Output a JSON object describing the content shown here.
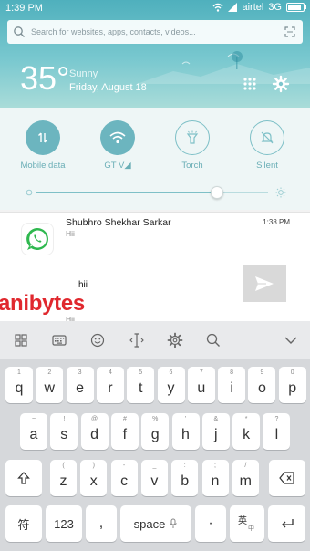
{
  "status_bar": {
    "time": "1:39 PM",
    "carrier": "airtel",
    "network": "3G",
    "battery_level": 0.8
  },
  "search": {
    "placeholder": "Search for websites, apps, contacts, videos..."
  },
  "weather": {
    "temperature": "35°",
    "condition": "Sunny",
    "date": "Friday, August 18"
  },
  "toggles": [
    {
      "label": "Mobile data",
      "icon": "data-arrows-icon",
      "state": "on"
    },
    {
      "label": "GT V◢",
      "icon": "wifi-icon",
      "state": "on"
    },
    {
      "label": "Torch",
      "icon": "torch-icon",
      "state": "off"
    },
    {
      "label": "Silent",
      "icon": "bell-off-icon",
      "state": "off"
    }
  ],
  "brightness": {
    "level": 0.78
  },
  "notification": {
    "app_icon": "whatsapp-icon",
    "sender": "Shubhro Shekhar Sarkar",
    "time": "1:38 PM",
    "message": "Hii",
    "reply_text": "hii",
    "message_repeat": "Hii",
    "watermark": "anibytes"
  },
  "keyboard": {
    "toolbar_icons": [
      "grid-icon",
      "keyboard-icon",
      "emoji-icon",
      "cursor-icon",
      "settings-icon",
      "search-icon",
      "collapse-icon"
    ],
    "row1": [
      {
        "hint": "1",
        "key": "q"
      },
      {
        "hint": "2",
        "key": "w"
      },
      {
        "hint": "3",
        "key": "e"
      },
      {
        "hint": "4",
        "key": "r"
      },
      {
        "hint": "5",
        "key": "t"
      },
      {
        "hint": "6",
        "key": "y"
      },
      {
        "hint": "7",
        "key": "u"
      },
      {
        "hint": "8",
        "key": "i"
      },
      {
        "hint": "9",
        "key": "o"
      },
      {
        "hint": "0",
        "key": "p"
      }
    ],
    "row2": [
      {
        "hint": "~",
        "key": "a"
      },
      {
        "hint": "!",
        "key": "s"
      },
      {
        "hint": "@",
        "key": "d"
      },
      {
        "hint": "#",
        "key": "f"
      },
      {
        "hint": "%",
        "key": "g"
      },
      {
        "hint": "'",
        "key": "h"
      },
      {
        "hint": "&",
        "key": "j"
      },
      {
        "hint": "*",
        "key": "k"
      },
      {
        "hint": "?",
        "key": "l"
      }
    ],
    "row3": [
      {
        "hint": "(",
        "key": "z"
      },
      {
        "hint": ")",
        "key": "x"
      },
      {
        "hint": "-",
        "key": "c"
      },
      {
        "hint": "_",
        "key": "v"
      },
      {
        "hint": ":",
        "key": "b"
      },
      {
        "hint": ";",
        "key": "n"
      },
      {
        "hint": "/",
        "key": "m"
      }
    ],
    "symbol_key": "符",
    "numbers_key": "123",
    "comma_key": ",",
    "space_label": "space",
    "period_key": "·",
    "lang_key": "英",
    "lang_sub": "中"
  }
}
